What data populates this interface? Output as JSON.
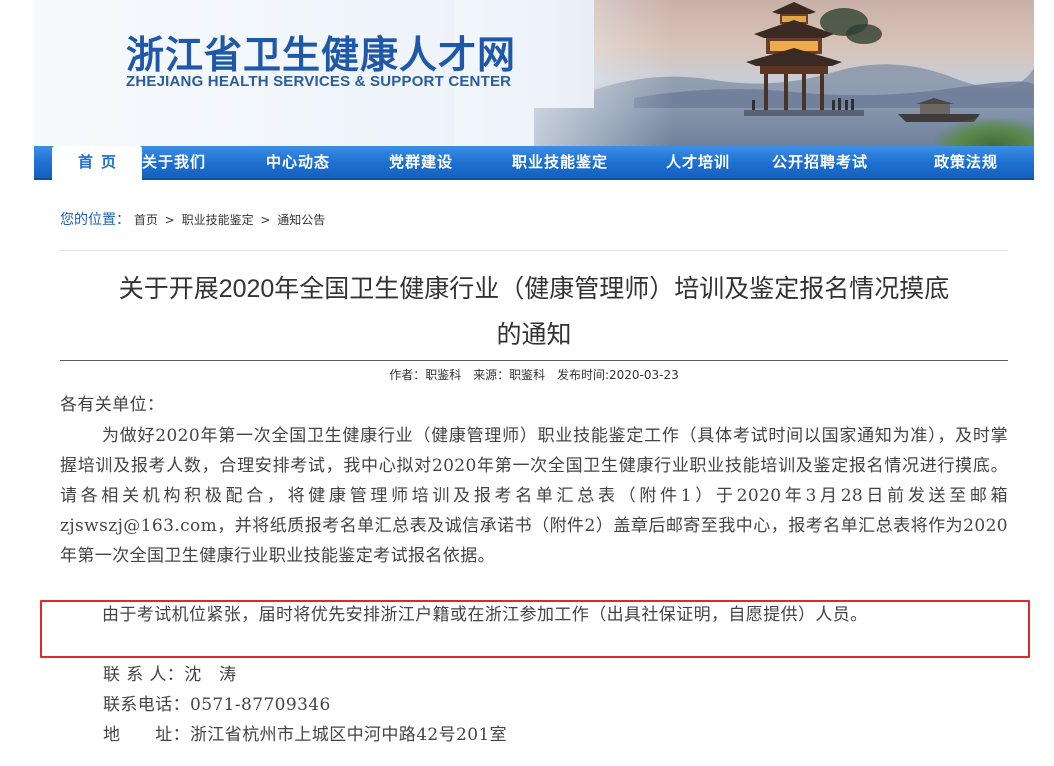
{
  "header": {
    "title": "浙江省卫生健康人才网",
    "subtitle": "ZHEJIANG HEALTH SERVICES & SUPPORT CENTER"
  },
  "nav": {
    "items": [
      {
        "label": "首页",
        "active": true
      },
      {
        "label": "关于我们"
      },
      {
        "label": "中心动态"
      },
      {
        "label": "党群建设"
      },
      {
        "label": "职业技能鉴定"
      },
      {
        "label": "人才培训"
      },
      {
        "label": "公开招聘考试"
      },
      {
        "label": "政策法规"
      }
    ]
  },
  "breadcrumb": {
    "label": "您的位置",
    "colon": "：",
    "items": [
      "首页",
      "职业技能鉴定",
      "通知公告"
    ],
    "separator": ">"
  },
  "article": {
    "title_line1": "关于开展2020年全国卫生健康行业（健康管理师）培训及鉴定报名情况摸底",
    "title_line2": "的通知",
    "meta": {
      "author": "作者：职鉴科",
      "source": "来源：职鉴科",
      "published": "发布时间:2020-03-23"
    },
    "salutation": "各有关单位：",
    "paragraph1": "为做好2020年第一次全国卫生健康行业（健康管理师）职业技能鉴定工作（具体考试时间以国家通知为准），及时掌握培训及报考人数，合理安排考试，我中心拟对2020年第一次全国卫生健康行业职业技能培训及鉴定报名情况进行摸底。请各相关机构积极配合，将健康管理师培训及报考名单汇总表（附件1）于2020年3月28日前发送至邮箱zjswszj@163.com，并将纸质报考名单汇总表及诚信承诺书（附件2）盖章后邮寄至我中心，报考名单汇总表将作为2020年第一次全国卫生健康行业职业技能鉴定考试报名依据。",
    "paragraph2": "由于考试机位紧张，届时将优先安排浙江户籍或在浙江参加工作（出具社保证明，自愿提供）人员。",
    "contact": {
      "person": "联 系 人：沈　涛",
      "phone": "联系电话：0571-87709346",
      "address": "地　　址：浙江省杭州市上城区中河中路42号201室"
    }
  },
  "colors": {
    "brand_blue": "#1d6fd1",
    "title_blue": "#1f58a8",
    "highlight_red": "#e0282c"
  }
}
